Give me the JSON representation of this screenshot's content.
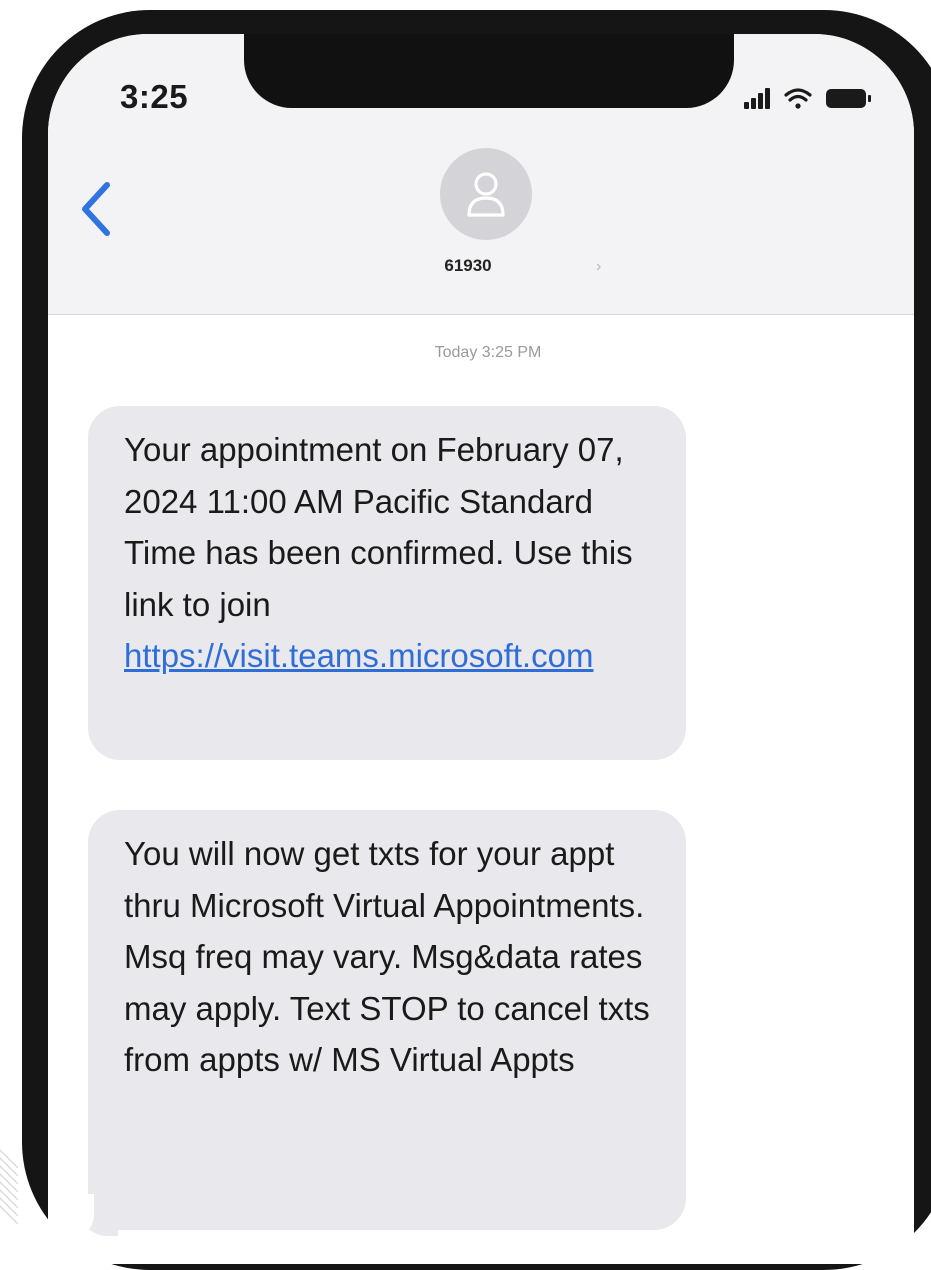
{
  "status_bar": {
    "time": "3:25"
  },
  "header": {
    "contact_name": "61930"
  },
  "timestamp": "Today 3:25 PM",
  "messages": [
    {
      "text": "Your appointment on February 07, 2024 11:00 AM Pacific Standard Time has been confirmed. Use this link to join ",
      "link": "https://visit.teams.microsoft.com"
    },
    {
      "text": "You will now get txts for your appt thru Microsoft Virtual Appointments. Msq freq may vary. Msg&data rates may apply. Text STOP to cancel txts from appts w/ MS Virtual Appts"
    }
  ],
  "icons": {
    "back": "chevron-left-icon",
    "avatar": "person-icon",
    "signal": "signal-bars-icon",
    "wifi": "wifi-icon",
    "battery": "battery-icon",
    "contact_details": "chevron-right-icon"
  },
  "colors": {
    "link": "#2f6ed8",
    "incoming_bubble": "#e9e9ed",
    "header_bg": "#f3f3f5",
    "back_accent": "#2f74e0",
    "timestamp_gray": "#9a9a9f"
  }
}
